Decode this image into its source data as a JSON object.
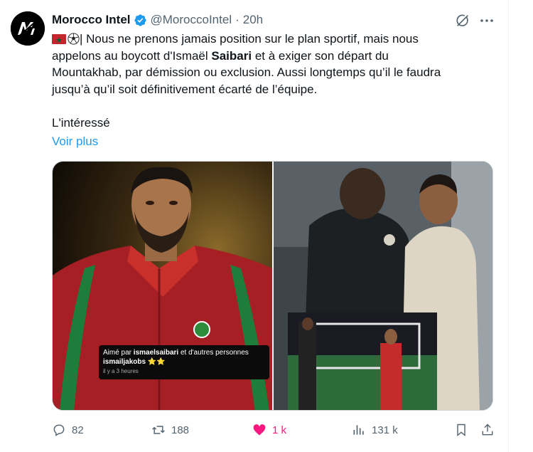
{
  "tweet": {
    "author_name": "Morocco Intel",
    "handle": "@MoroccoIntel",
    "separator": "·",
    "time": "20h",
    "avatar_text": "MI",
    "text_lines": [
      "| Nous ne prenons jamais position sur le plan sportif, mais nous",
      "appelons au boycott d'Ismaël ",
      "Saibari",
      " et à exiger son départ du",
      "Mountakhab, par démission ou exclusion. Aussi longtemps qu’il le faudra",
      "jusqu’à qu’il soit définitivement écarté de l’équipe.",
      "L'intéressé"
    ],
    "show_more": "Voir plus"
  },
  "media": {
    "overlay_line1_prefix": "Aimé par ",
    "overlay_line1_user": "ismaelsaibari",
    "overlay_line1_suffix": " et d'autres personnes",
    "overlay_line2": "ismailjakobs ⭐⭐",
    "overlay_time": "il y a 3 heures"
  },
  "actions": {
    "replies": "82",
    "retweets": "188",
    "likes": "1 k",
    "views": "131 k"
  },
  "colors": {
    "accent": "#1d9bf0",
    "like": "#f91880",
    "muted": "#536471"
  },
  "icons": [
    "verified-icon",
    "grok-icon",
    "more-icon",
    "reply-icon",
    "retweet-icon",
    "like-icon",
    "views-icon",
    "bookmark-icon",
    "share-icon"
  ]
}
